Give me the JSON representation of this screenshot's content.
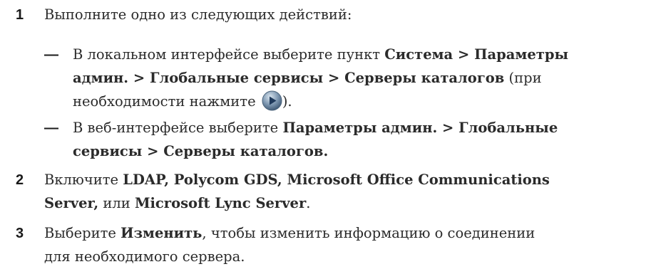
{
  "steps": [
    {
      "number": "1",
      "text": "Выполните одно из следующих действий:"
    },
    {
      "bullet": "—",
      "line1_prefix": "В локальном интерфейсе выберите пункт ",
      "line1_bold": "Система > Параметры",
      "line2_bold": "админ. > Глобальные сервисы > Серверы каталогов",
      "line2_suffix": " (при",
      "line3_prefix": "необходимости нажмите ",
      "line3_suffix": ")."
    },
    {
      "bullet": "—",
      "line1_prefix": "В веб-интерфейсе выберите ",
      "line1_bold": "Параметры админ. > Глобальные",
      "line2_bold": "сервисы > Серверы каталогов."
    },
    {
      "number": "2",
      "line1_prefix": "Включите ",
      "line1_bold": "LDAP, Polycom GDS, Microsoft Office Communications",
      "line2_bold_a": "Server,",
      "line2_mid": " или ",
      "line2_bold_b": "Microsoft Lync Server",
      "line2_suffix": "."
    },
    {
      "number": "3",
      "line1_prefix": "Выберите ",
      "line1_bold": "Изменить",
      "line1_suffix": ", чтобы изменить информацию о соединении",
      "line2": "для необходимого сервера."
    }
  ],
  "icon": {
    "name": "play-icon",
    "color": "#3e6e9a"
  }
}
